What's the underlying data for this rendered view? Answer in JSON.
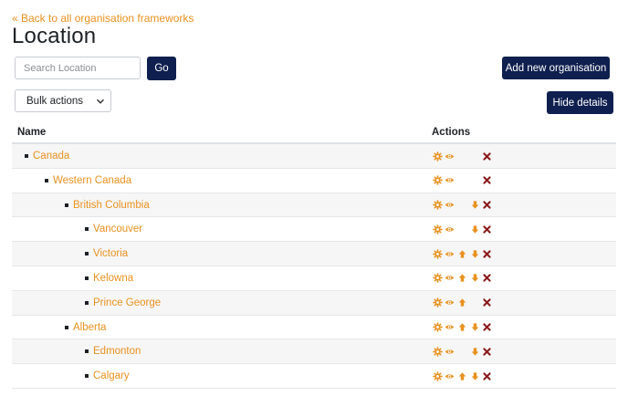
{
  "header": {
    "back_link": "« Back to all organisation frameworks",
    "title": "Location"
  },
  "search": {
    "placeholder": "Search Location",
    "go_label": "Go"
  },
  "toolbar": {
    "add_label": "Add new organisation",
    "hide_label": "Hide details",
    "bulk_label": "Bulk actions"
  },
  "table": {
    "col_name": "Name",
    "col_actions": "Actions",
    "rows": [
      {
        "label": "Canada",
        "depth": 0,
        "actions": [
          "gear",
          "eye",
          "delete"
        ]
      },
      {
        "label": "Western Canada",
        "depth": 1,
        "actions": [
          "gear",
          "eye",
          "delete"
        ]
      },
      {
        "label": "British Columbia",
        "depth": 2,
        "actions": [
          "gear",
          "eye",
          "down",
          "delete"
        ]
      },
      {
        "label": "Vancouver",
        "depth": 3,
        "actions": [
          "gear",
          "eye",
          "down",
          "delete"
        ]
      },
      {
        "label": "Victoria",
        "depth": 3,
        "actions": [
          "gear",
          "eye",
          "up",
          "down",
          "delete"
        ]
      },
      {
        "label": "Kelowna",
        "depth": 3,
        "actions": [
          "gear",
          "eye",
          "up",
          "down",
          "delete"
        ]
      },
      {
        "label": "Prince George",
        "depth": 3,
        "actions": [
          "gear",
          "eye",
          "up",
          "delete"
        ]
      },
      {
        "label": "Alberta",
        "depth": 2,
        "actions": [
          "gear",
          "eye",
          "up",
          "down",
          "delete"
        ]
      },
      {
        "label": "Edmonton",
        "depth": 3,
        "actions": [
          "gear",
          "eye",
          "down",
          "delete"
        ]
      },
      {
        "label": "Calgary",
        "depth": 3,
        "actions": [
          "gear",
          "eye",
          "up",
          "down",
          "delete"
        ]
      }
    ]
  },
  "colors": {
    "accent": "#e8911e",
    "primary_button": "#0f1f4f",
    "delete": "#8b1a1a"
  }
}
